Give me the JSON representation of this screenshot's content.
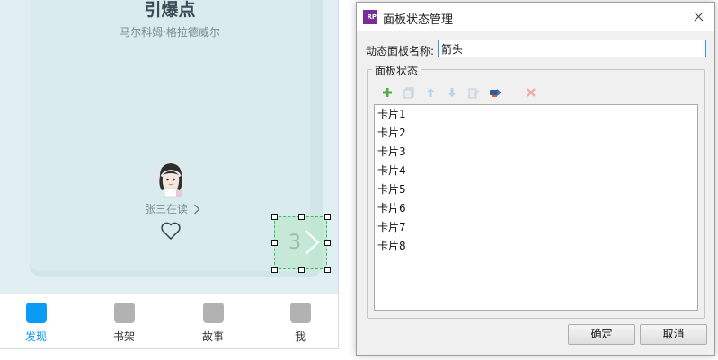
{
  "phone": {
    "book_title": "引爆点",
    "book_author": "马尔科姆·格拉德威尔",
    "reader_text": "张三在读",
    "selection_number": "3",
    "tabs": [
      {
        "label": "发现",
        "active": true
      },
      {
        "label": "书架",
        "active": false
      },
      {
        "label": "故事",
        "active": false
      },
      {
        "label": "我",
        "active": false
      }
    ],
    "colors": {
      "accent": "#0a9bf5",
      "background": "#e1eff2",
      "selection": "#32c25b"
    }
  },
  "dialog": {
    "app_icon_text": "RP",
    "title": "面板状态管理",
    "name_label": "动态面板名称:",
    "name_value": "箭头",
    "group_title": "面板状态",
    "toolbar_icons": [
      "add-icon",
      "duplicate-icon",
      "move-up-icon",
      "move-down-icon",
      "edit-all-icon",
      "edit-state-icon",
      "delete-icon"
    ],
    "states": [
      "卡片1",
      "卡片2",
      "卡片3",
      "卡片4",
      "卡片5",
      "卡片6",
      "卡片7",
      "卡片8"
    ],
    "ok_label": "确定",
    "cancel_label": "取消"
  }
}
